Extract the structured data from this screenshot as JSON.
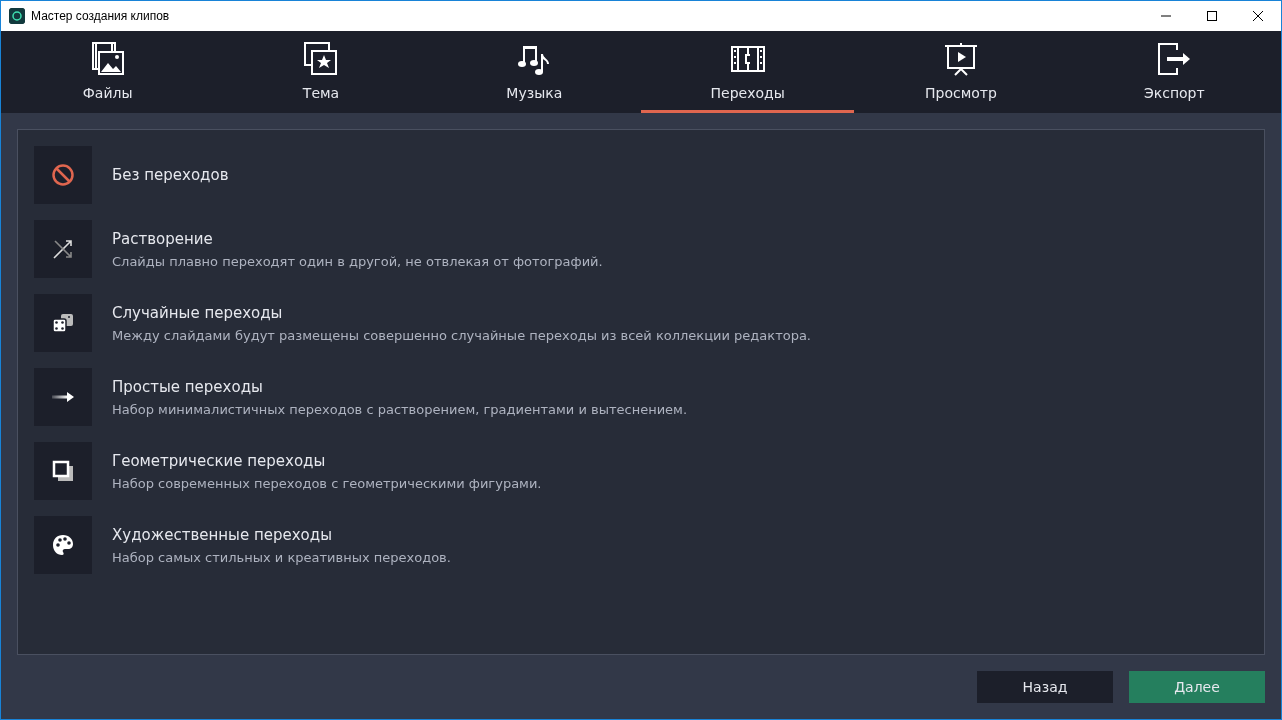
{
  "window": {
    "title": "Мастер создания клипов"
  },
  "tabs": [
    {
      "label": "Файлы",
      "kind": "files",
      "selected": false
    },
    {
      "label": "Тема",
      "kind": "theme",
      "selected": false
    },
    {
      "label": "Музыка",
      "kind": "music",
      "selected": false
    },
    {
      "label": "Переходы",
      "kind": "transitions",
      "selected": true
    },
    {
      "label": "Просмотр",
      "kind": "preview",
      "selected": false
    },
    {
      "label": "Экспорт",
      "kind": "export",
      "selected": false
    }
  ],
  "options": [
    {
      "kind": "none",
      "title": "Без переходов"
    },
    {
      "kind": "dissolve",
      "title": "Растворение",
      "description": "Слайды плавно переходят один в другой, не отвлекая от фотографий."
    },
    {
      "kind": "random",
      "title": "Случайные переходы",
      "description": "Между слайдами будут размещены совершенно случайные переходы из всей коллекции редактора."
    },
    {
      "kind": "simple",
      "title": "Простые переходы",
      "description": "Набор минималистичных переходов с растворением, градиентами и вытеснением."
    },
    {
      "kind": "geometric",
      "title": "Геометрические переходы",
      "description": "Набор современных переходов с геометрическими фигурами."
    },
    {
      "kind": "artistic",
      "title": "Художественные переходы",
      "description": "Набор самых стильных и креативных переходов."
    }
  ],
  "buttons": [
    {
      "label": "Назад",
      "kind": "secondary"
    },
    {
      "label": "Далее",
      "kind": "primary"
    }
  ]
}
